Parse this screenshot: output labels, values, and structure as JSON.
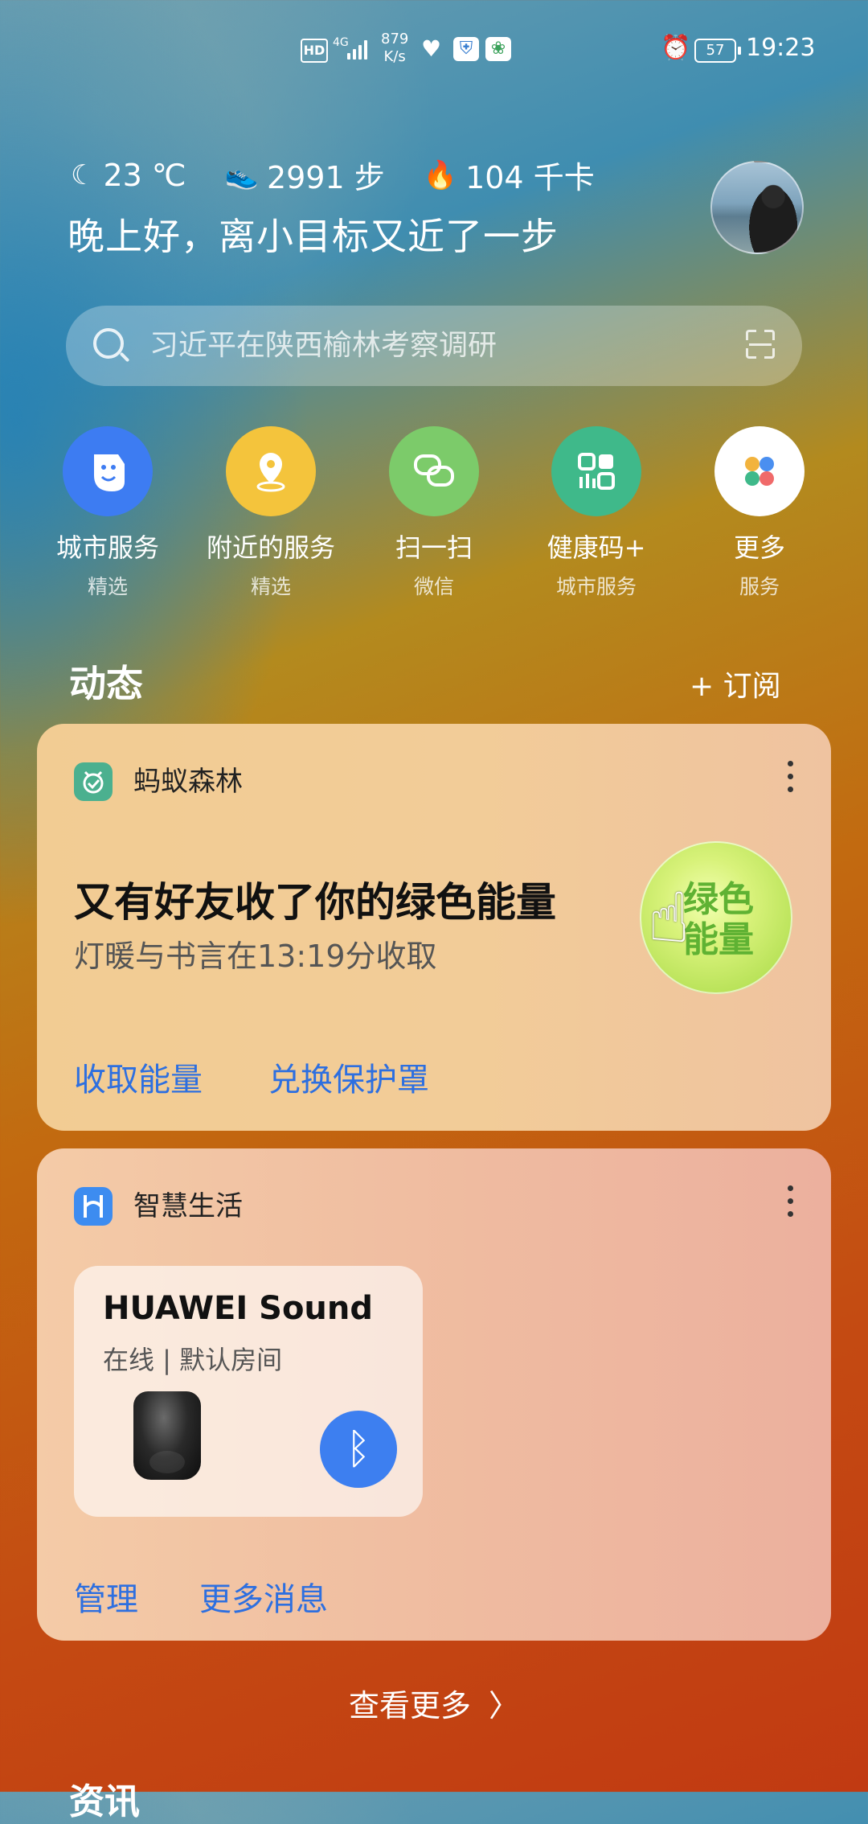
{
  "status_bar": {
    "hd": "HD",
    "network": "4G",
    "speed_value": "879",
    "speed_unit": "K/s",
    "battery": "57",
    "time": "19:23"
  },
  "header": {
    "temperature": "23 ℃",
    "steps": "2991 步",
    "calories": "104 千卡",
    "greeting": "晚上好，离小目标又近了一步"
  },
  "search": {
    "placeholder": "习近平在陕西榆林考察调研"
  },
  "shortcuts": [
    {
      "name": "城市服务",
      "sub": "精选",
      "color": "#3d7cf2"
    },
    {
      "name": "附近的服务",
      "sub": "精选",
      "color": "#f4c43c"
    },
    {
      "name": "扫一扫",
      "sub": "微信",
      "color": "#7ccb6a"
    },
    {
      "name": "健康码+",
      "sub": "城市服务",
      "color": "#3fb98a"
    },
    {
      "name": "更多",
      "sub": "服务",
      "color": "#ffffff"
    }
  ],
  "feed": {
    "title": "动态",
    "subscribe": "+ 订阅"
  },
  "card_forest": {
    "app_name": "蚂蚁森林",
    "headline": "又有好友收了你的绿色能量",
    "subline": "灯暖与书言在13:19分收取",
    "bubble_text": "绿色能量",
    "action1": "收取能量",
    "action2": "兑换保护罩"
  },
  "card_life": {
    "app_name": "智慧生活",
    "device_name": "HUAWEI Sound",
    "device_status": "在线 | 默认房间",
    "action1": "管理",
    "action2": "更多消息"
  },
  "see_more": "查看更多",
  "next_section": "资讯"
}
